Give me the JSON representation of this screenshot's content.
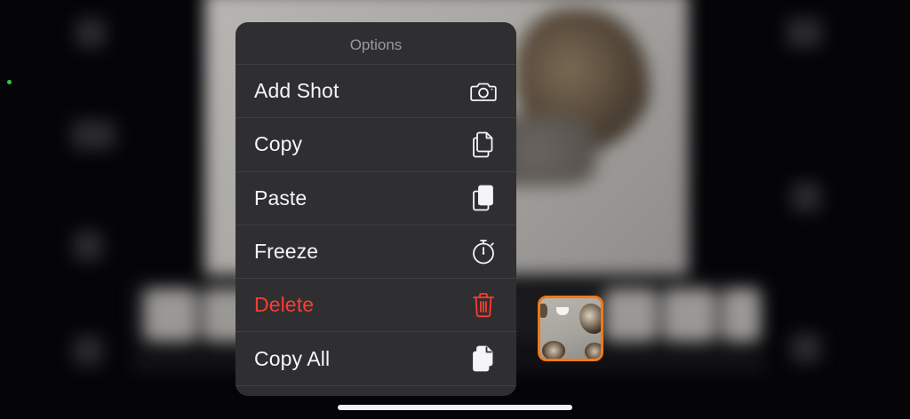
{
  "menu": {
    "title": "Options",
    "items": [
      {
        "label": "Add Shot",
        "icon": "camera-icon",
        "style": "default"
      },
      {
        "label": "Copy",
        "icon": "copy-icon",
        "style": "default"
      },
      {
        "label": "Paste",
        "icon": "paste-icon",
        "style": "default"
      },
      {
        "label": "Freeze",
        "icon": "stopwatch-icon",
        "style": "default"
      },
      {
        "label": "Delete",
        "icon": "trash-icon",
        "style": "destructive"
      },
      {
        "label": "Copy All",
        "icon": "copy-all-icon",
        "style": "default"
      }
    ]
  },
  "colors": {
    "menu_background": "#2f2f31",
    "destructive": "#ff3b30",
    "selection_border": "#f07a1a",
    "text": "#f5f5f7",
    "title_text": "#9a9a9e"
  }
}
